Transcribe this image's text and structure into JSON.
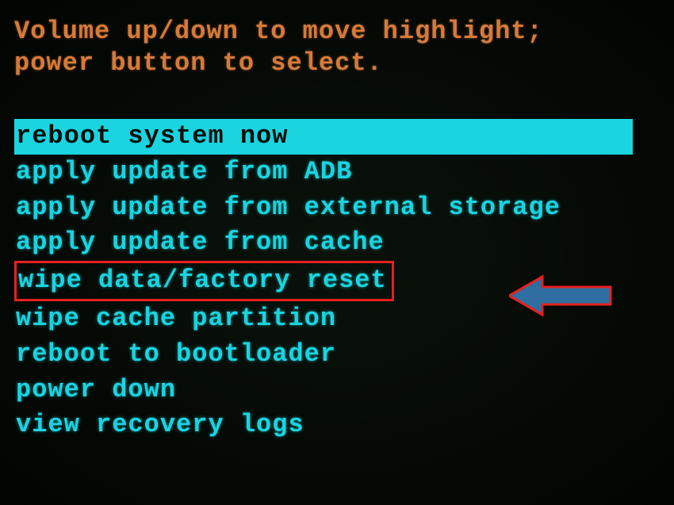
{
  "instructions": {
    "line1": "Volume up/down to move highlight;",
    "line2": "power button to select."
  },
  "menu": {
    "items": [
      {
        "label": "reboot system now",
        "selected": true
      },
      {
        "label": "apply update from ADB"
      },
      {
        "label": "apply update from external storage"
      },
      {
        "label": "apply update from cache"
      },
      {
        "label": "wipe data/factory reset",
        "outlined": true
      },
      {
        "label": "wipe cache partition"
      },
      {
        "label": "reboot to bootloader"
      },
      {
        "label": "power down"
      },
      {
        "label": "view recovery logs"
      }
    ]
  },
  "annotation": {
    "arrow_color": "#2f6ea0",
    "arrow_stroke": "#e62020",
    "outline_color": "#e62020"
  }
}
